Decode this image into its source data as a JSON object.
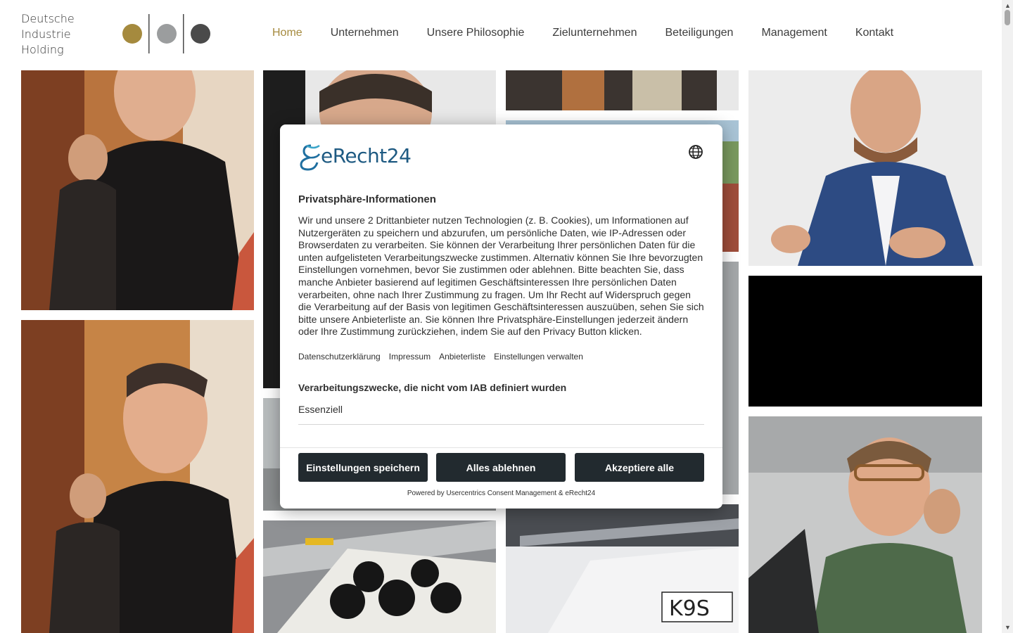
{
  "brand": {
    "logo_lines": [
      "Deutsche",
      "Industrie",
      "Holding"
    ],
    "dot_colors": [
      "#a58a3e",
      "#9b9d9e",
      "#4a4a4a"
    ]
  },
  "nav": {
    "items": [
      {
        "label": "Home",
        "active": true
      },
      {
        "label": "Unternehmen"
      },
      {
        "label": "Unsere Philosophie"
      },
      {
        "label": "Zielunternehmen"
      },
      {
        "label": "Beteiligungen"
      },
      {
        "label": "Management"
      },
      {
        "label": "Kontakt"
      }
    ],
    "active_color": "#a58a3e"
  },
  "gallery": {
    "tiles": [
      "photo-laughing-man-turtleneck",
      "photo-man-glasses",
      "photo-group-suits",
      "photo-aerial-town",
      "photo-man-blue-suit",
      "photo-black-video",
      "photo-laughing-man-turtleneck-2",
      "photo-factory-hall",
      "photo-machine-rollers",
      "photo-truss-k9s-sign",
      "photo-man-green-sweater"
    ],
    "sign_text": "K9S"
  },
  "consent": {
    "provider": "eRecht24",
    "language_icon": "globe-icon",
    "title": "Privatsphäre-Informationen",
    "body": "Wir und unsere 2 Drittanbieter nutzen Technologien (z. B. Cookies), um Informationen auf Nutzergeräten zu speichern und abzurufen, um persönliche Daten, wie IP-Adressen oder Browserdaten zu verarbeiten. Sie können der Verarbeitung Ihrer persönlichen Daten für die unten aufgelisteten Verarbeitungszwecke zustimmen. Alternativ können Sie Ihre bevorzugten Einstellungen vornehmen, bevor Sie zustimmen oder ablehnen. Bitte beachten Sie, dass manche Anbieter basierend auf legitimen Geschäftsinteressen Ihre persönlichen Daten verarbeiten, ohne nach Ihrer Zustimmung zu fragen. Um Ihr Recht auf Widerspruch gegen die Verarbeitung auf der Basis von legitimen Geschäftsinteressen auszuüben, sehen Sie sich bitte unsere Anbieterliste an. Sie können Ihre Privatsphäre-Einstellungen jederzeit ändern oder Ihre Zustimmung zurückziehen, indem Sie auf den Privacy Button klicken.",
    "links": [
      "Datenschutzerklärung",
      "Impressum",
      "Anbieterliste",
      "Einstellungen verwalten"
    ],
    "purposes_title": "Verarbeitungszwecke, die nicht vom IAB definiert wurden",
    "purpose_item": "Essenziell",
    "buttons": {
      "save": "Einstellungen speichern",
      "reject": "Alles ablehnen",
      "accept": "Akzeptiere alle"
    },
    "powered_by": "Powered by Usercentrics Consent Management & eRecht24",
    "button_color": "#222a2f"
  }
}
